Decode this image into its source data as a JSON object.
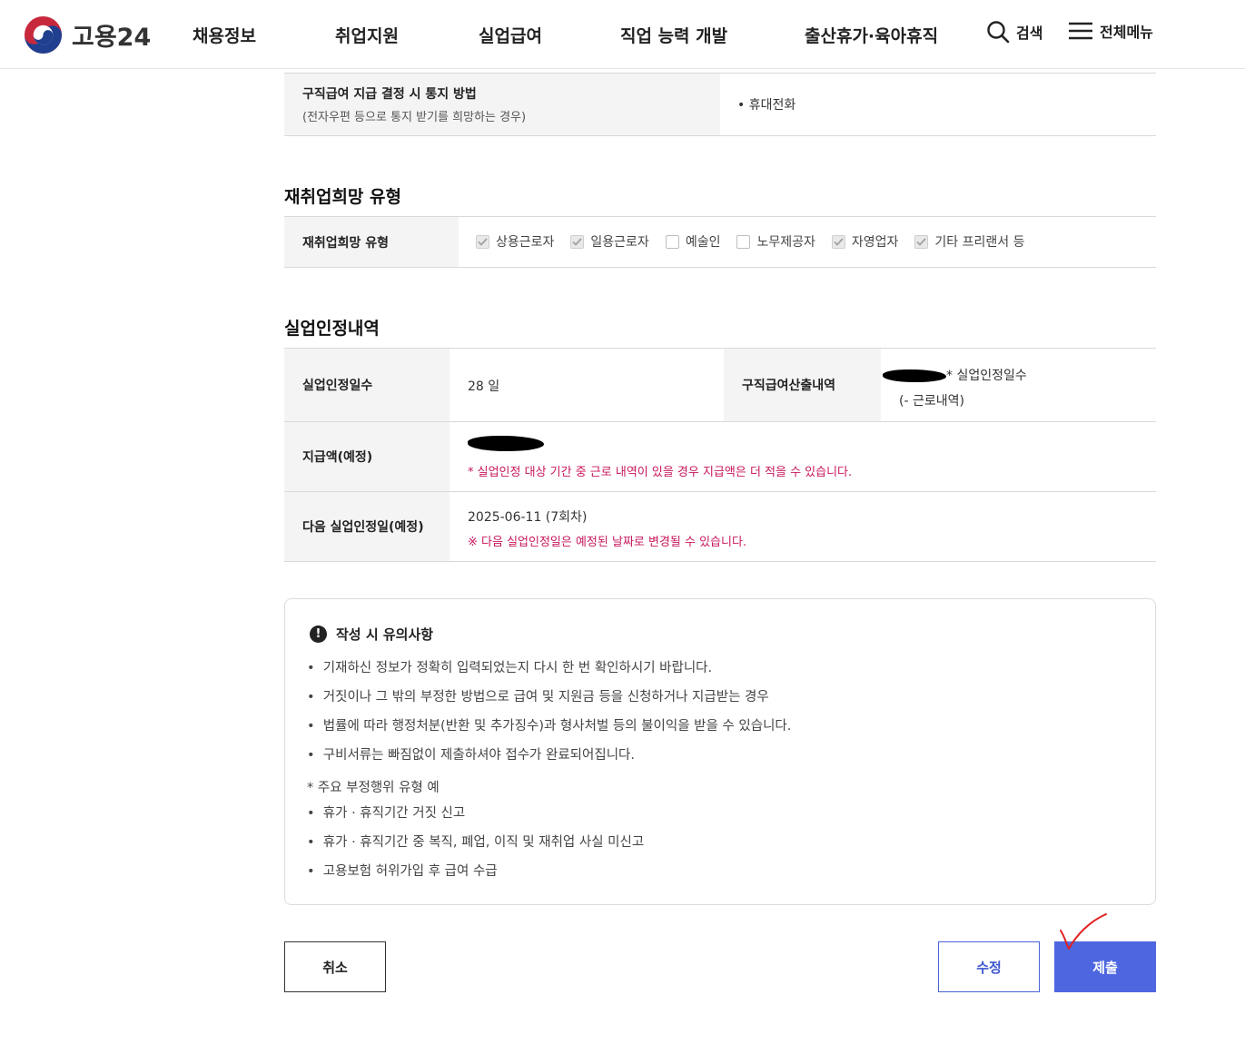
{
  "header": {
    "logo_text": "고용24",
    "nav": [
      "채용정보",
      "취업지원",
      "실업급여",
      "직업 능력 개발",
      "출산휴가·육아휴직"
    ],
    "search_label": "검색",
    "menu_label": "전체메뉴"
  },
  "notify": {
    "label": "구직급여 지급 결정 시 통지 방법",
    "sublabel": "(전자우편 등으로 통지 받기를 희망하는 경우)",
    "value": "휴대전화"
  },
  "reemployment": {
    "title": "재취업희망 유형",
    "label": "재취업희망 유형",
    "options": [
      {
        "label": "상용근로자",
        "checked": true
      },
      {
        "label": "일용근로자",
        "checked": true
      },
      {
        "label": "예술인",
        "checked": false
      },
      {
        "label": "노무제공자",
        "checked": false
      },
      {
        "label": "자영업자",
        "checked": true
      },
      {
        "label": "기타 프리랜서 등",
        "checked": true
      }
    ]
  },
  "recognition": {
    "title": "실업인정내역",
    "days_label": "실업인정일수",
    "days_value": "28 일",
    "calc_label": "구직급여산출내역",
    "calc_value_line1": "* 실업인정일수",
    "calc_value_line2": "(- 근로내역)",
    "amount_label": "지급액(예정)",
    "amount_note": "* 실업인정 대상 기간 중 근로 내역이 있을 경우 지급액은 더 적을 수 있습니다.",
    "next_label": "다음 실업인정일(예정)",
    "next_value": "2025-06-11 (7회차)",
    "next_note": "※ 다음 실업인정일은 예정된 날짜로 변경될 수 있습니다."
  },
  "notice": {
    "title": "작성 시 유의사항",
    "items": [
      "기재하신 정보가 정확히 입력되었는지 다시 한 번 확인하시기 바랍니다.",
      "거짓이나 그 밖의 부정한 방법으로 급여 및 지원금 등을 신청하거나 지급받는 경우",
      "법률에 따라 행정처분(반환 및 추가징수)과 형사처벌 등의 불이익을 받을 수 있습니다.",
      "구비서류는 빠짐없이 제출하셔야 접수가 완료되어집니다."
    ],
    "subheading": "* 주요 부정행위 유형 예",
    "examples": [
      "휴가 · 휴직기간 거짓 신고",
      "휴가 · 휴직기간 중 복직, 폐업, 이직 및 재취업 사실 미신고",
      "고용보험 허위가입 후 급여 수급"
    ]
  },
  "buttons": {
    "cancel": "취소",
    "edit": "수정",
    "submit": "제출"
  },
  "colors": {
    "primary": "#4e67e1",
    "note": "#c8175d",
    "annotation": "#e02020"
  }
}
